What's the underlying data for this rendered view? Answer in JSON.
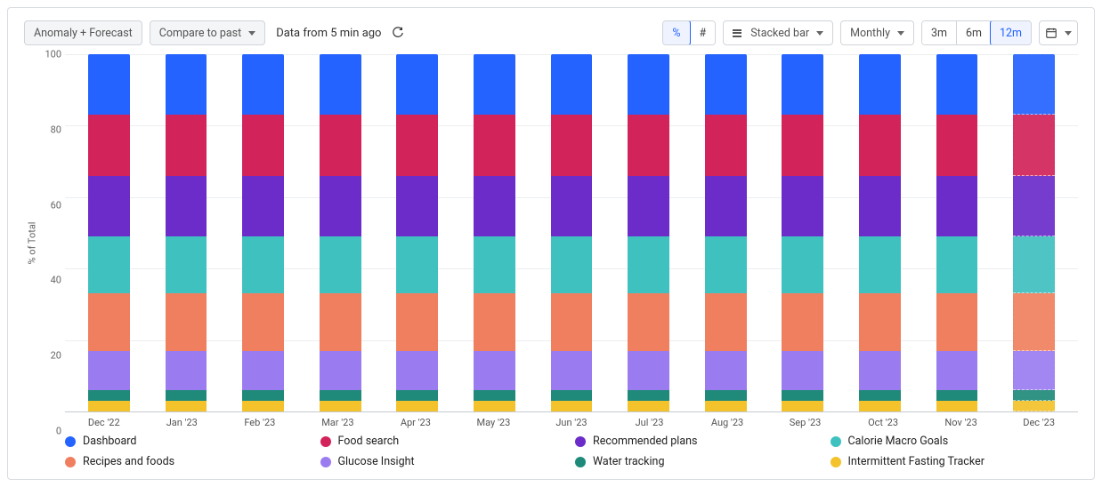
{
  "toolbar": {
    "anomaly_forecast_label": "Anomaly + Forecast",
    "compare_label": "Compare to past",
    "status": "Data from 5 min ago",
    "unit_percent": "%",
    "unit_count": "#",
    "chart_type_label": "Stacked bar",
    "interval_label": "Monthly",
    "range_3m": "3m",
    "range_6m": "6m",
    "range_12m": "12m"
  },
  "colors": {
    "Dashboard": "#2463ff",
    "Food search": "#d2235b",
    "Recommended plans": "#6b2cc9",
    "Calorie Macro Goals": "#3fc1c0",
    "Recipes and foods": "#f07f5f",
    "Glucose Insight": "#9b7cf0",
    "Water tracking": "#1f8a7a",
    "Intermittent Fasting Tracker": "#f4c22b"
  },
  "chart_data": {
    "type": "bar",
    "stacked": true,
    "normalize": "percent",
    "ylabel": "% of Total",
    "xlabel": "",
    "ylim": [
      0,
      100
    ],
    "yticks": [
      0,
      20,
      40,
      60,
      80,
      100
    ],
    "categories": [
      "Dec '22",
      "Jan '23",
      "Feb '23",
      "Mar '23",
      "Apr '23",
      "May '23",
      "Jun '23",
      "Jul '23",
      "Aug '23",
      "Sep '23",
      "Oct '23",
      "Nov '23",
      "Dec '23"
    ],
    "forecast_categories": [
      "Dec '23"
    ],
    "stack_order_bottom_to_top": [
      "Intermittent Fasting Tracker",
      "Water tracking",
      "Glucose Insight",
      "Recipes and foods",
      "Calorie Macro Goals",
      "Recommended plans",
      "Food search",
      "Dashboard"
    ],
    "series": [
      {
        "name": "Intermittent Fasting Tracker",
        "values": [
          3,
          3,
          3,
          3,
          3,
          3,
          3,
          3,
          3,
          3,
          3,
          3,
          3
        ]
      },
      {
        "name": "Water tracking",
        "values": [
          3,
          3,
          3,
          3,
          3,
          3,
          3,
          3,
          3,
          3,
          3,
          3,
          3
        ]
      },
      {
        "name": "Glucose Insight",
        "values": [
          11,
          11,
          11,
          11,
          11,
          11,
          11,
          11,
          11,
          11,
          11,
          11,
          11
        ]
      },
      {
        "name": "Recipes and foods",
        "values": [
          16,
          16,
          16,
          16,
          16,
          16,
          16,
          16,
          16,
          16,
          16,
          16,
          16
        ]
      },
      {
        "name": "Calorie Macro Goals",
        "values": [
          16,
          16,
          16,
          16,
          16,
          16,
          16,
          16,
          16,
          16,
          16,
          16,
          16
        ]
      },
      {
        "name": "Recommended plans",
        "values": [
          17,
          17,
          17,
          17,
          17,
          17,
          17,
          17,
          17,
          17,
          17,
          17,
          17
        ]
      },
      {
        "name": "Food search",
        "values": [
          17,
          17,
          17,
          17,
          17,
          17,
          17,
          17,
          17,
          17,
          17,
          17,
          17
        ]
      },
      {
        "name": "Dashboard",
        "values": [
          17,
          17,
          17,
          17,
          17,
          17,
          17,
          17,
          17,
          17,
          17,
          17,
          17
        ]
      }
    ],
    "legend_layout": [
      [
        "Dashboard",
        "Food search",
        "Recommended plans",
        "Calorie Macro Goals"
      ],
      [
        "Recipes and foods",
        "Glucose Insight",
        "Water tracking",
        "Intermittent Fasting Tracker"
      ]
    ]
  }
}
